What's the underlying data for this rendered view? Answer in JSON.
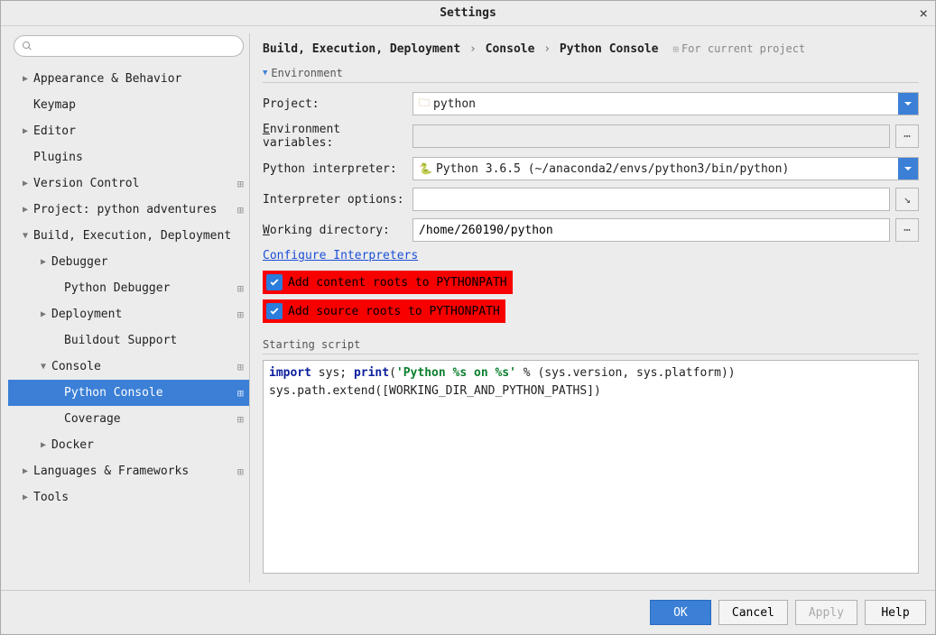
{
  "title": "Settings",
  "breadcrumb": {
    "part1": "Build, Execution, Deployment",
    "part2": "Console",
    "part3": "Python Console",
    "project_tag": "For current project"
  },
  "tree": [
    {
      "label": "Appearance & Behavior",
      "indent": 1,
      "caret": "right"
    },
    {
      "label": "Keymap",
      "indent": 1,
      "caret": "none"
    },
    {
      "label": "Editor",
      "indent": 1,
      "caret": "right"
    },
    {
      "label": "Plugins",
      "indent": 1,
      "caret": "none"
    },
    {
      "label": "Version Control",
      "indent": 1,
      "caret": "right",
      "badge": true
    },
    {
      "label": "Project: python adventures",
      "indent": 1,
      "caret": "right",
      "badge": true
    },
    {
      "label": "Build, Execution, Deployment",
      "indent": 1,
      "caret": "down"
    },
    {
      "label": "Debugger",
      "indent": 2,
      "caret": "right"
    },
    {
      "label": "Python Debugger",
      "indent": 3,
      "caret": "none",
      "badge": true
    },
    {
      "label": "Deployment",
      "indent": 2,
      "caret": "right",
      "badge": true
    },
    {
      "label": "Buildout Support",
      "indent": 3,
      "caret": "none"
    },
    {
      "label": "Console",
      "indent": 2,
      "caret": "down",
      "badge": true
    },
    {
      "label": "Python Console",
      "indent": 3,
      "caret": "none",
      "badge": true,
      "selected": true
    },
    {
      "label": "Coverage",
      "indent": 3,
      "caret": "none",
      "badge": true
    },
    {
      "label": "Docker",
      "indent": 2,
      "caret": "right"
    },
    {
      "label": "Languages & Frameworks",
      "indent": 1,
      "caret": "right",
      "badge": true
    },
    {
      "label": "Tools",
      "indent": 1,
      "caret": "right"
    }
  ],
  "environment": {
    "section_title": "Environment",
    "labels": {
      "project": "Project:",
      "env_vars": "Environment variables:",
      "interpreter": "Python interpreter:",
      "interp_opts": "Interpreter options:",
      "work_dir": "Working directory:"
    },
    "project": "python",
    "env_vars": "",
    "interpreter": "Python 3.6.5 (~/anaconda2/envs/python3/bin/python)",
    "interp_opts": "",
    "work_dir": "/home/260190/python",
    "configure_link": "Configure Interpreters",
    "check1": "Add content roots to PYTHONPATH",
    "check2": "Add source roots to PYTHONPATH"
  },
  "script": {
    "section_title": "Starting script",
    "line1_kw": "import",
    "line1_rest": " sys; ",
    "line1_fn": "print",
    "line1_paren": "(",
    "line1_str": "'Python %s on %s'",
    "line1_tail": " % (sys.version, sys.platform))",
    "line2": "sys.path.extend([WORKING_DIR_AND_PYTHON_PATHS])"
  },
  "footer": {
    "ok": "OK",
    "cancel": "Cancel",
    "apply": "Apply",
    "help": "Help"
  }
}
